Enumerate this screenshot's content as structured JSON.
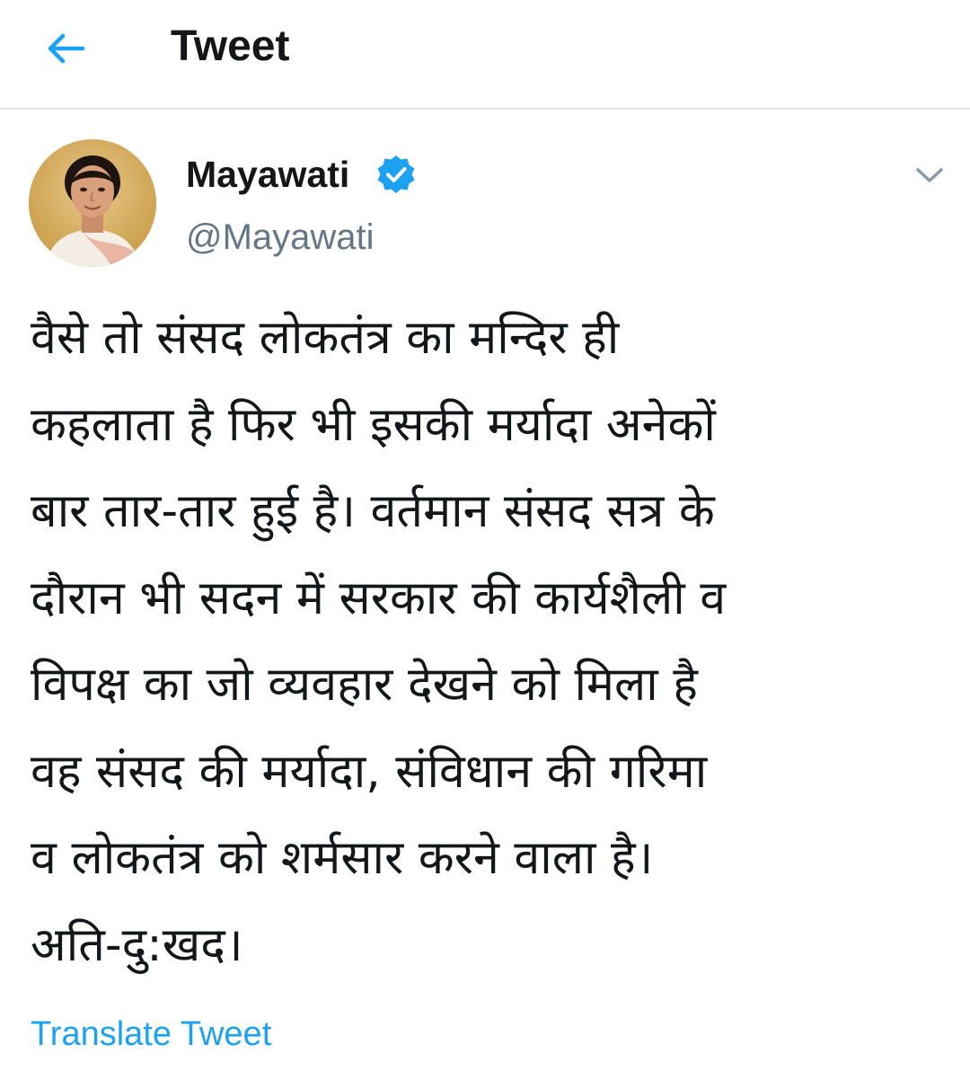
{
  "header": {
    "title": "Tweet",
    "back_icon": "arrow-left-icon"
  },
  "tweet": {
    "author": {
      "display_name": "Mayawati",
      "handle": "@Mayawati",
      "verified": true,
      "verified_icon": "verified-badge-icon",
      "avatar_icon": "profile-photo"
    },
    "menu_icon": "chevron-down-icon",
    "text": "वैसे तो संसद लोकतंत्र का मन्दिर ही\nकहलाता है फिर भी इसकी मर्यादा अनेकों\nबार तार-तार हुई है। वर्तमान संसद सत्र के\nदौरान भी सदन में सरकार की कार्यशैली व\nविपक्ष का जो व्यवहार देखने को मिला है\nवह संसद की मर्यादा, संविधान की गरिमा\nव लोकतंत्र को शर्मसार करने वाला है।\nअति-दु:खद।",
    "translate_label": "Translate Tweet"
  },
  "colors": {
    "accent": "#1da1f2",
    "text_primary": "#14171a",
    "text_secondary": "#657786",
    "divider": "#e1e8ed",
    "verified": "#1da1f2"
  }
}
